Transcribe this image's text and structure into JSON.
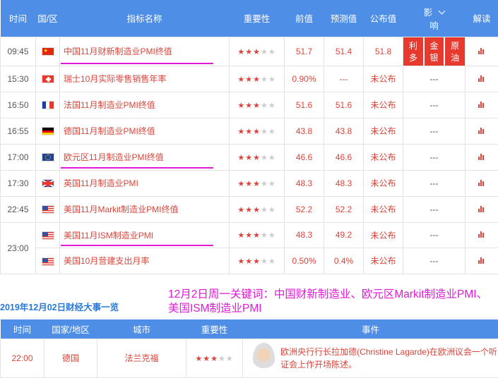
{
  "header": {
    "time": "时间",
    "region": "国/区",
    "indicator": "指标名称",
    "importance": "重要性",
    "previous": "前值",
    "forecast": "预测值",
    "actual": "公布值",
    "impact_top": "影",
    "impact_bottom": "响",
    "interpret": "解读"
  },
  "rows": [
    {
      "time": "09:45",
      "flag": "cn",
      "indicator": "中国11月财新制造业PMI终值",
      "stars": 3,
      "previous": "51.7",
      "forecast": "51.4",
      "actual": "51.8",
      "impact": [
        "利多",
        "金银",
        "原油"
      ],
      "underline": true
    },
    {
      "time": "15:30",
      "flag": "ch",
      "indicator": "瑞士10月实际零售销售年率",
      "stars": 3,
      "previous": "0.90%",
      "forecast": "---",
      "actual": "未公布",
      "impact": "---",
      "underline": false
    },
    {
      "time": "16:50",
      "flag": "fr",
      "indicator": "法国11月制造业PMI终值",
      "stars": 3,
      "previous": "51.6",
      "forecast": "51.6",
      "actual": "未公布",
      "impact": "---",
      "underline": false
    },
    {
      "time": "16:55",
      "flag": "de",
      "indicator": "德国11月制造业PMI终值",
      "stars": 3,
      "previous": "43.8",
      "forecast": "43.8",
      "actual": "未公布",
      "impact": "---",
      "underline": false
    },
    {
      "time": "17:00",
      "flag": "eu",
      "indicator": "欧元区11月制造业PMI终值",
      "stars": 3,
      "previous": "46.6",
      "forecast": "46.6",
      "actual": "未公布",
      "impact": "---",
      "underline": true
    },
    {
      "time": "17:30",
      "flag": "uk",
      "indicator": "英国11月制造业PMI",
      "stars": 3,
      "previous": "48.3",
      "forecast": "48.3",
      "actual": "未公布",
      "impact": "---",
      "underline": false
    },
    {
      "time": "22:45",
      "flag": "us",
      "indicator": "美国11月Markit制造业PMI终值",
      "stars": 3,
      "previous": "52.2",
      "forecast": "52.2",
      "actual": "未公布",
      "impact": "---",
      "underline": false
    },
    {
      "time": "23:00",
      "flag": "us",
      "indicator": "美国11月ISM制造业PMI",
      "stars": 3,
      "previous": "48.3",
      "forecast": "49.2",
      "actual": "未公布",
      "impact": "---",
      "underline": true
    },
    {
      "time": "",
      "flag": "us",
      "indicator": "美国10月营建支出月率",
      "stars": 3,
      "previous": "0.50%",
      "forecast": "0.4%",
      "actual": "未公布",
      "impact": "---",
      "underline": false
    }
  ],
  "section": {
    "title": "2019年12月02日财经大事一览",
    "keywords": "12月2日周一关键词：中国财新制造业、欧元区Markit制造业PMI、美国ISM制造业PMI"
  },
  "events_header": {
    "time": "时间",
    "country": "国家/地区",
    "city": "城市",
    "importance": "重要性",
    "event": "事件"
  },
  "events": [
    {
      "time": "22:00",
      "country": "德国",
      "city": "法兰克福",
      "stars": 3,
      "event": "欧洲央行行长拉加德(Christine Lagarde)在欧洲议会一个听证会上作开场陈述。"
    }
  ],
  "colors": {
    "header_bg": "#4e8ee6",
    "accent_red": "#d9453a",
    "highlight": "#e01ad6",
    "link_blue": "#2a79d8"
  }
}
